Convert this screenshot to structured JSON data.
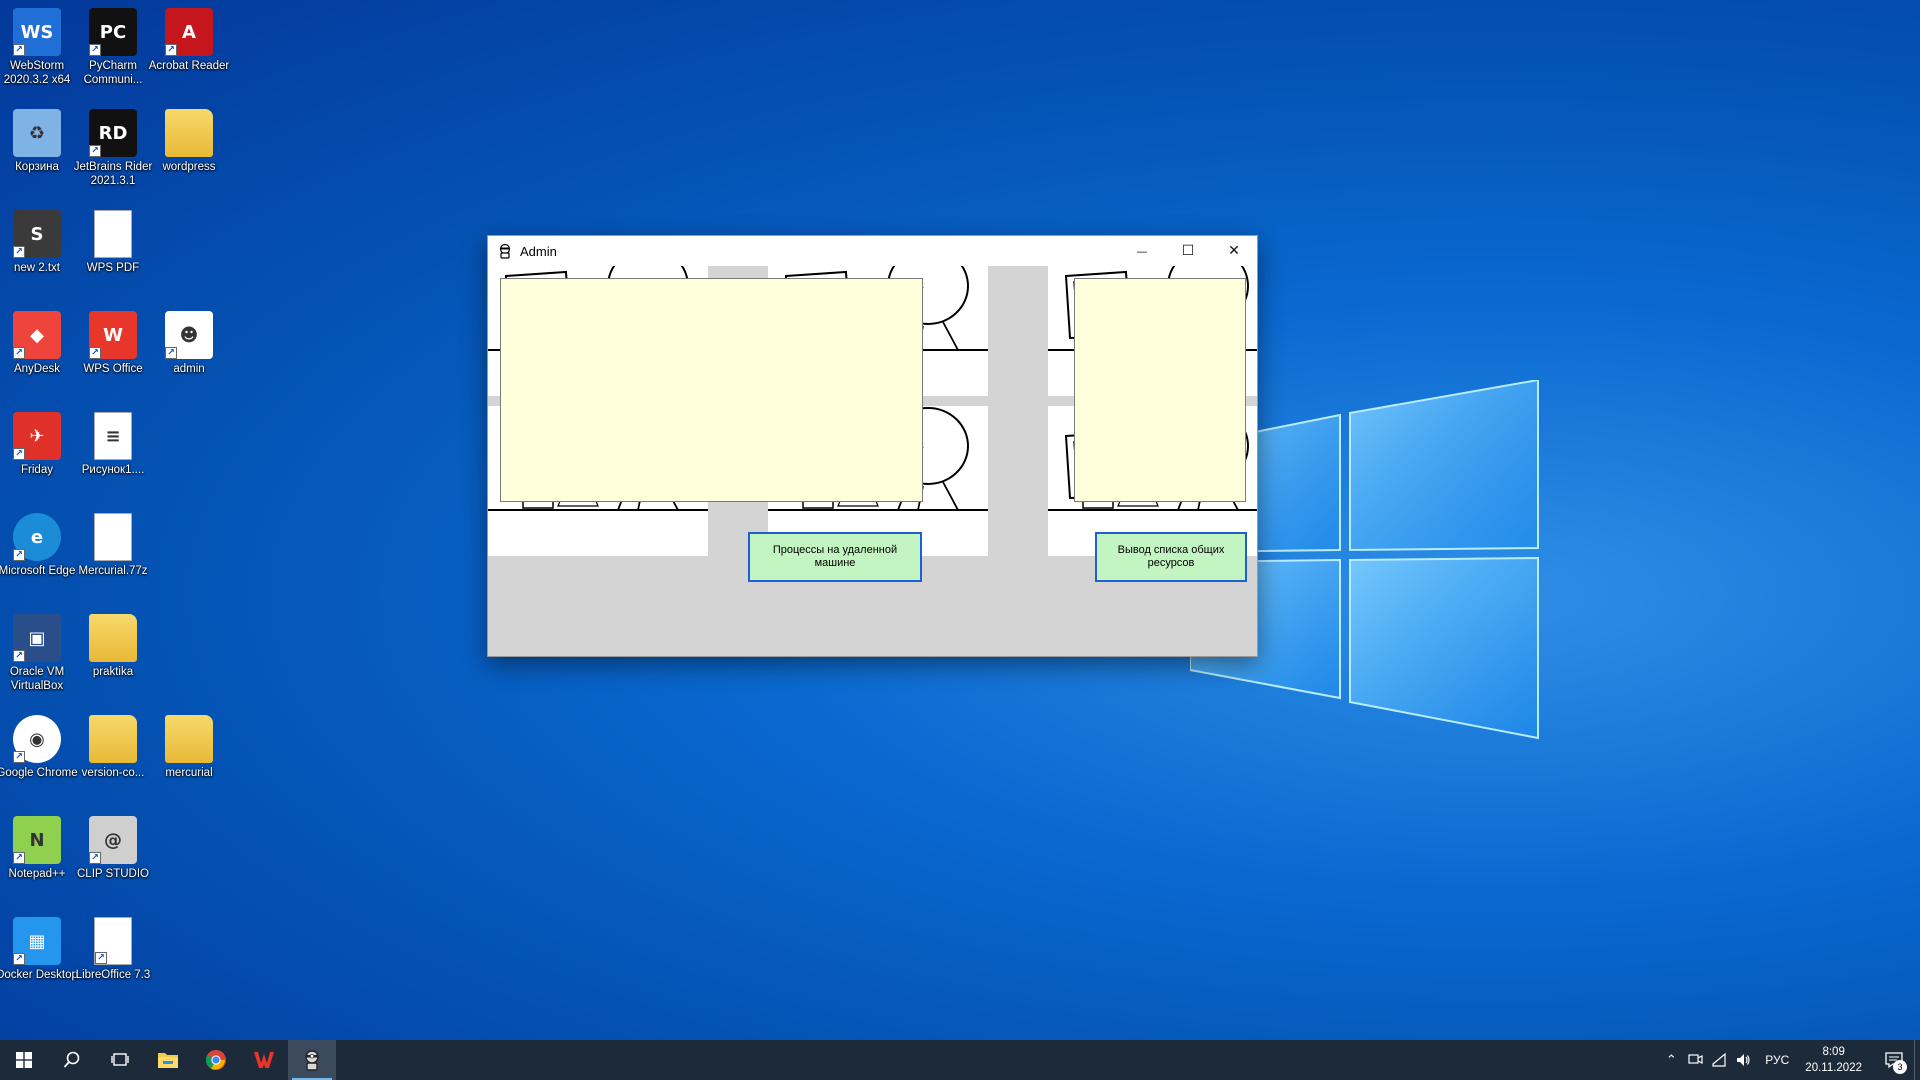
{
  "desktop": {
    "icons": [
      {
        "label": "WebStorm 2020.3.2 x64",
        "icon": "webstorm-icon",
        "color": "#1f6fd6"
      },
      {
        "label": "PyCharm Communi...",
        "icon": "pycharm-icon",
        "color": "#111111"
      },
      {
        "label": "Acrobat Reader",
        "icon": "acrobat-icon",
        "color": "#c4161c"
      },
      {
        "label": "Корзина",
        "icon": "recycle-bin-icon",
        "color": "#7fb2e5"
      },
      {
        "label": "JetBrains Rider 2021.3.1",
        "icon": "rider-icon",
        "color": "#111111"
      },
      {
        "label": "wordpress",
        "icon": "folder-icon",
        "color": "#f3c94a"
      },
      {
        "label": "new 2.txt",
        "icon": "sublime-icon",
        "color": "#3a3a3a"
      },
      {
        "label": "WPS PDF",
        "icon": "blank-file-icon",
        "color": "#ffffff"
      },
      {
        "label": "AnyDesk",
        "icon": "anydesk-icon",
        "color": "#ef443b"
      },
      {
        "label": "WPS Office",
        "icon": "wps-office-icon",
        "color": "#e8372a"
      },
      {
        "label": "admin",
        "icon": "admin-app-icon",
        "color": "#ffffff"
      },
      {
        "label": "Friday",
        "icon": "friday-bird-icon",
        "color": "#e0302a"
      },
      {
        "label": "Рисунок1....",
        "icon": "spreadsheet-file-icon",
        "color": "#ffffff"
      },
      {
        "label": "Microsoft Edge",
        "icon": "edge-icon",
        "color": "#1a8cd8"
      },
      {
        "label": "Mercurial.77z",
        "icon": "blank-file-icon",
        "color": "#ffffff"
      },
      {
        "label": "Oracle VM VirtualBox",
        "icon": "virtualbox-icon",
        "color": "#2a4e8a"
      },
      {
        "label": "praktika",
        "icon": "folder-icon",
        "color": "#f3c94a"
      },
      {
        "label": "Google Chrome",
        "icon": "chrome-icon",
        "color": "#ffffff"
      },
      {
        "label": "version-co...",
        "icon": "folder-icon",
        "color": "#f3c94a"
      },
      {
        "label": "mercurial",
        "icon": "folder-icon",
        "color": "#f3c94a"
      },
      {
        "label": "Notepad++",
        "icon": "notepadpp-icon",
        "color": "#8fd14f"
      },
      {
        "label": "CLIP STUDIO",
        "icon": "clip-studio-icon",
        "color": "#cfcfcf"
      },
      {
        "label": "Docker Desktop",
        "icon": "docker-icon",
        "color": "#2496ed"
      },
      {
        "label": "LibreOffice 7.3",
        "icon": "libreoffice-icon",
        "color": "#ffffff"
      }
    ]
  },
  "window": {
    "title": "Admin",
    "minimize_symbol": "—",
    "maximize_symbol": "☐",
    "close_symbol": "✕",
    "buttons": {
      "processes": "Процессы на удаленной машине",
      "shares": "Вывод списка общих ресурсов"
    },
    "colors": {
      "text_area_bg": "#ffffdc",
      "button_bg": "#c3f5c3",
      "button_border": "#1f5fd6"
    }
  },
  "taskbar": {
    "pinned": [
      {
        "icon": "windows-start-icon"
      },
      {
        "icon": "search-icon"
      },
      {
        "icon": "task-view-icon"
      },
      {
        "icon": "file-explorer-icon"
      },
      {
        "icon": "chrome-icon"
      },
      {
        "icon": "wps-office-icon"
      },
      {
        "icon": "admin-app-icon"
      }
    ],
    "tray": {
      "language": "РУС",
      "time": "8:09",
      "date": "20.11.2022",
      "notification_count": "3"
    }
  }
}
